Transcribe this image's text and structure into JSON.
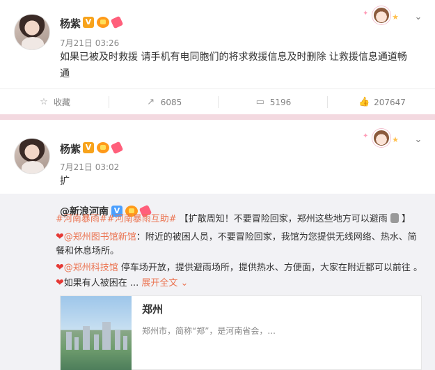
{
  "post1": {
    "author": "杨紫",
    "verified_badge": "V",
    "time": "7月21日 03:26",
    "text_line1": "如果已被及时救援 请手机有电同胞们的将求救援信息及时删除 让救援信息通道畅",
    "text_line2": "通",
    "actions": {
      "favorite": "收藏",
      "repost": "6085",
      "comment": "5196",
      "like": "207647"
    }
  },
  "post2": {
    "author": "杨紫",
    "verified_badge": "V",
    "time": "7月21日 03:02",
    "text": "扩",
    "repost": {
      "author": "@新浪河南",
      "verified_badge": "V",
      "tag1": "#河南暴雨#",
      "tag2": "#河南暴雨互助#",
      "line1_text": "【扩散周知！不要冒险回家，郑州这些地方可以避雨",
      "line1_end": "】",
      "mention1": "@郑州图书馆新馆",
      "mention1_text": "：附近的被困人员，不要冒险回家，我馆为您提供无线网络、热水、简",
      "mention1_text2": "餐和休息场所。",
      "mention2": "@郑州科技馆",
      "mention2_text": " 停车场开放，提供避雨场所，提供热水、方便面，大家在附近都可以前往 。",
      "line4_text": "如果有人被困在 ... ",
      "expand": "展开全文",
      "card": {
        "title": "郑州",
        "description": "郑州市，简称“郑”，是河南省会，..."
      }
    }
  },
  "colors": {
    "accent": "#eb7350",
    "background": "#f3d9e0",
    "verified": "#f7a31c"
  }
}
